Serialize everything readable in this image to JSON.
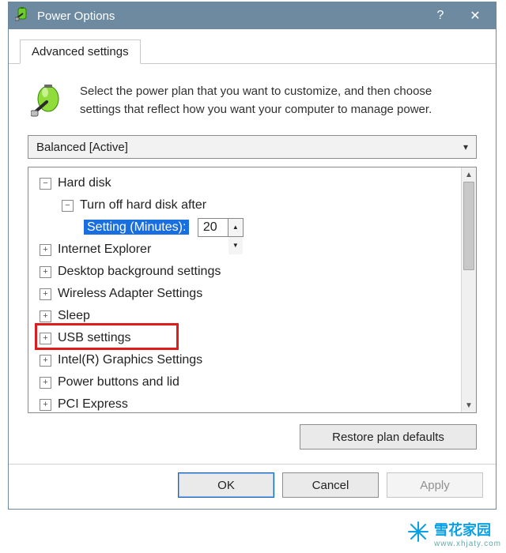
{
  "titlebar": {
    "title": "Power Options"
  },
  "tab": {
    "label": "Advanced settings"
  },
  "intro": {
    "text": "Select the power plan that you want to customize, and then choose settings that reflect how you want your computer to manage power."
  },
  "plan_select": {
    "selected": "Balanced [Active]"
  },
  "tree": {
    "hard_disk": {
      "label": "Hard disk"
    },
    "turn_off": {
      "label": "Turn off hard disk after"
    },
    "setting_label": "Setting (Minutes):",
    "setting_value": "20",
    "internet_explorer": {
      "label": "Internet Explorer"
    },
    "desktop_bg": {
      "label": "Desktop background settings"
    },
    "wireless": {
      "label": "Wireless Adapter Settings"
    },
    "sleep": {
      "label": "Sleep"
    },
    "usb": {
      "label": "USB settings"
    },
    "intel_gfx": {
      "label": "Intel(R) Graphics Settings"
    },
    "power_buttons": {
      "label": "Power buttons and lid"
    },
    "pci": {
      "label": "PCI Express"
    }
  },
  "buttons": {
    "restore": "Restore plan defaults",
    "ok": "OK",
    "cancel": "Cancel",
    "apply": "Apply"
  },
  "watermark": {
    "name": "雪花家园",
    "url": "www.xhjaty.com"
  }
}
